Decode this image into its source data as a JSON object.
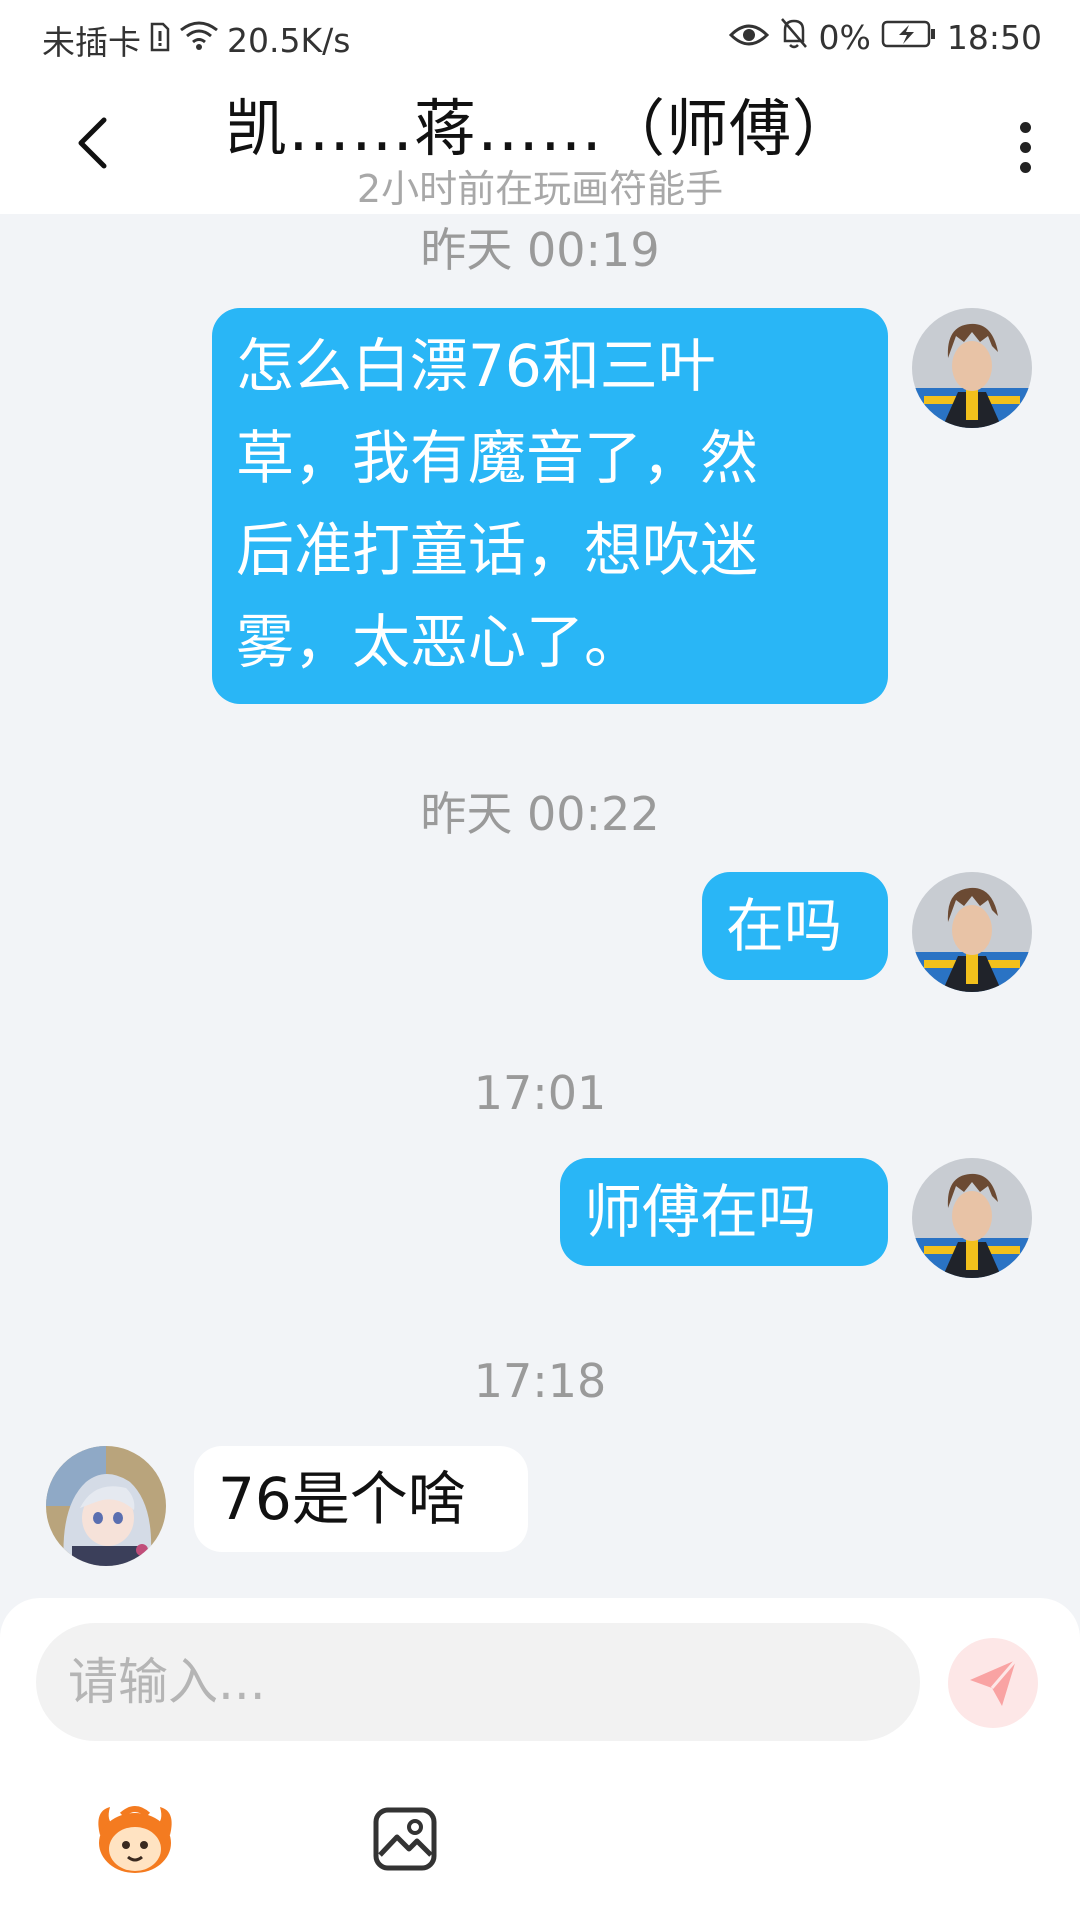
{
  "status_bar": {
    "carrier": "未插卡",
    "net_speed": "20.5K/s",
    "battery": "0%",
    "time": "18:50"
  },
  "header": {
    "title": "凯……蒋……（师傅）",
    "subtitle": "2小时前在玩画符能手"
  },
  "messages": [
    {
      "time": "昨天 00:19",
      "from": "me",
      "lines": [
        "怎么白漂76和三叶",
        "草，我有魔音了，然",
        "后准打童话，想吹迷",
        "雾，太恶心了。"
      ]
    },
    {
      "time": "昨天 00:22",
      "from": "me",
      "text": "在吗"
    },
    {
      "time": "17:01",
      "from": "me",
      "text": "师傅在吗"
    },
    {
      "time": "17:18",
      "from": "other",
      "text": "76是个啥"
    }
  ],
  "input": {
    "placeholder": "请输入..."
  },
  "colors": {
    "my_bubble": "#29b6f6",
    "background": "#f2f4f7",
    "send_button": "#f98b8b"
  },
  "icons": {
    "back": "chevron-left-icon",
    "more": "more-vertical-icon",
    "send": "send-icon",
    "emoji": "emoji-mascot-icon",
    "image": "image-icon"
  }
}
